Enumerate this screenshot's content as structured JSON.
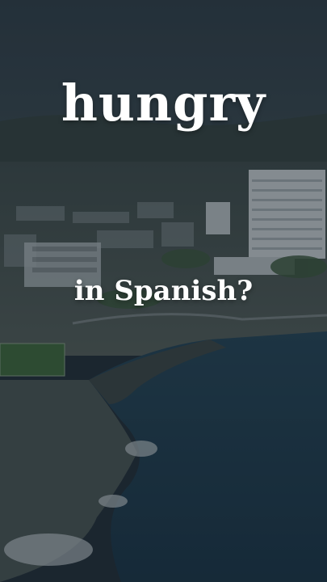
{
  "overlay": {
    "word": "hungry",
    "question": "in Spanish?"
  },
  "scene": {
    "description_colors": {
      "sky": "#2b3a44",
      "sea": "#1d3747",
      "land": "#4a5a58",
      "buildings": "#c9cfd2",
      "field": "#3f6b3a"
    }
  }
}
